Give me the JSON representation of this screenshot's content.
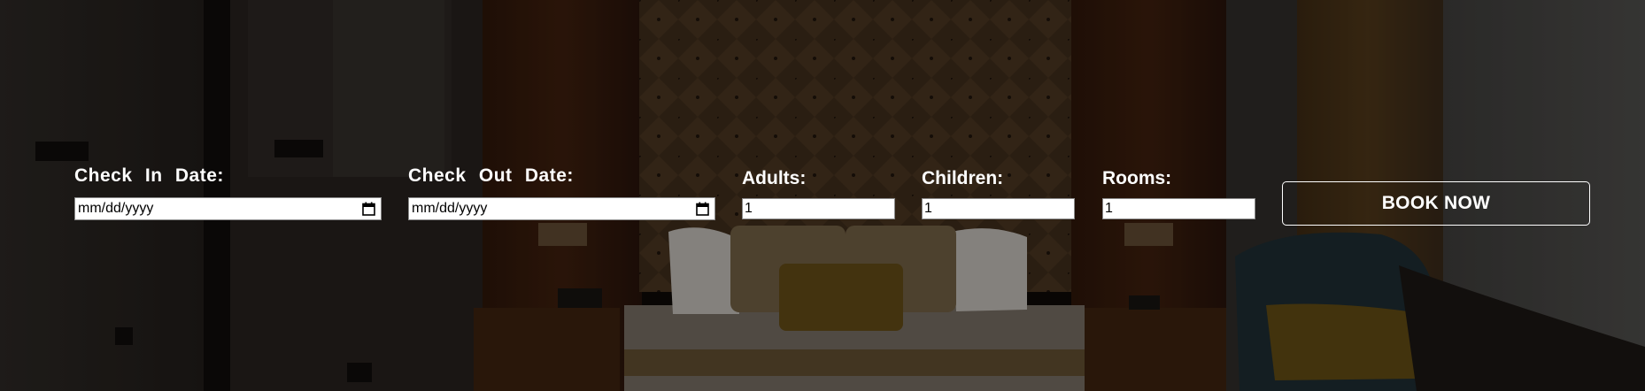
{
  "background": {
    "scene": "hotel-bedroom-photo",
    "overlay_color": "#000000"
  },
  "booking_form": {
    "check_in": {
      "label": "Check In Date:",
      "placeholder": "mm/dd/yyyy",
      "icon": "calendar-icon"
    },
    "check_out": {
      "label": "Check Out Date:",
      "placeholder": "mm/dd/yyyy",
      "icon": "calendar-icon"
    },
    "adults": {
      "label": "Adults:",
      "value": "1"
    },
    "children": {
      "label": "Children:",
      "value": "1"
    },
    "rooms": {
      "label": "Rooms:",
      "value": "1"
    },
    "submit_label": "BOOK NOW"
  },
  "colors": {
    "text": "#ffffff",
    "input_bg": "#ffffff",
    "button_border": "#ffffff"
  }
}
